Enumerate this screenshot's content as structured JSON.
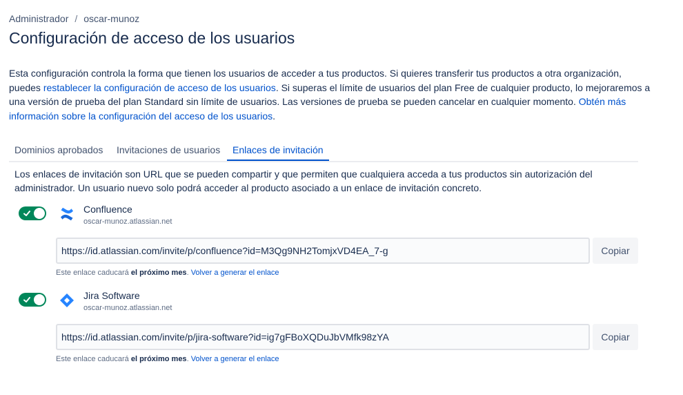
{
  "breadcrumb": {
    "root": "Administrador",
    "separator": "/",
    "current": "oscar-munoz"
  },
  "page_title": "Configuración de acceso de los usuarios",
  "intro": {
    "text1": "Esta configuración controla la forma que tienen los usuarios de acceder a tus productos. Si quieres transferir tus productos a otra organización, puedes ",
    "link1": "restablecer la configuración de acceso de los usuarios",
    "text2": ". Si superas el límite de usuarios del plan Free de cualquier producto, lo mejoraremos a una versión de prueba del plan Standard sin límite de usuarios. Las versiones de prueba se pueden cancelar en cualquier momento. ",
    "link2": "Obtén más información sobre la configuración del acceso de los usuarios",
    "text3": "."
  },
  "tabs": [
    {
      "label": "Dominios aprobados",
      "active": false
    },
    {
      "label": "Invitaciones de usuarios",
      "active": false
    },
    {
      "label": "Enlaces de invitación",
      "active": true
    }
  ],
  "tab_description": "Los enlaces de invitación son URL que se pueden compartir y que permiten que cualquiera acceda a tus productos sin autorización del administrador. Un usuario nuevo solo podrá acceder al producto asociado a un enlace de invitación concreto.",
  "products": [
    {
      "name": "Confluence",
      "site": "oscar-munoz.atlassian.net",
      "icon": "confluence-icon",
      "enabled": true,
      "url": "https://id.atlassian.com/invite/p/confluence?id=M3Qg9NH2TomjxVD4EA_7-g",
      "copy_label": "Copiar",
      "expiry_prefix": "Este enlace caducará ",
      "expiry_bold": "el próximo mes",
      "expiry_suffix": ". ",
      "regenerate_label": "Volver a generar el enlace"
    },
    {
      "name": "Jira Software",
      "site": "oscar-munoz.atlassian.net",
      "icon": "jira-software-icon",
      "enabled": true,
      "url": "https://id.atlassian.com/invite/p/jira-software?id=ig7gFBoXQDuJbVMfk98zYA",
      "copy_label": "Copiar",
      "expiry_prefix": "Este enlace caducará ",
      "expiry_bold": "el próximo mes",
      "expiry_suffix": ". ",
      "regenerate_label": "Volver a generar el enlace"
    }
  ],
  "colors": {
    "accent": "#0052cc",
    "toggle_on": "#00875a",
    "text": "#172b4d",
    "subtle": "#5e6c84"
  }
}
